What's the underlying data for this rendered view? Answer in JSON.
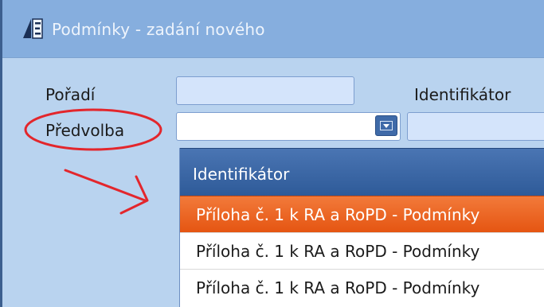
{
  "window": {
    "title": "Podmínky - zadání nového"
  },
  "form": {
    "poradi_label": "Pořadí",
    "poradi_value": "",
    "identifikator_label": "Identifikátor",
    "identifikator_value": "",
    "predvolba_label": "Předvolba",
    "predvolba_value": ""
  },
  "dropdown": {
    "column_header": "Identifikátor",
    "items": [
      {
        "label": "Příloha č. 1 k RA a RoPD - Podmínky",
        "selected": true
      },
      {
        "label": "Příloha č. 1 k RA a RoPD - Podmínky",
        "selected": false
      },
      {
        "label": "Příloha č. 1 k RA a RoPD - Podmínky",
        "selected": false
      }
    ]
  },
  "colors": {
    "titlebar": "#86aede",
    "window_bg": "#b9d3ef",
    "header_bg": "#2e5a98",
    "selected_row": "#e55512",
    "annotation": "#e3262c"
  },
  "icons": {
    "app": "app-e-icon",
    "dropdown": "chevron-down-icon"
  }
}
